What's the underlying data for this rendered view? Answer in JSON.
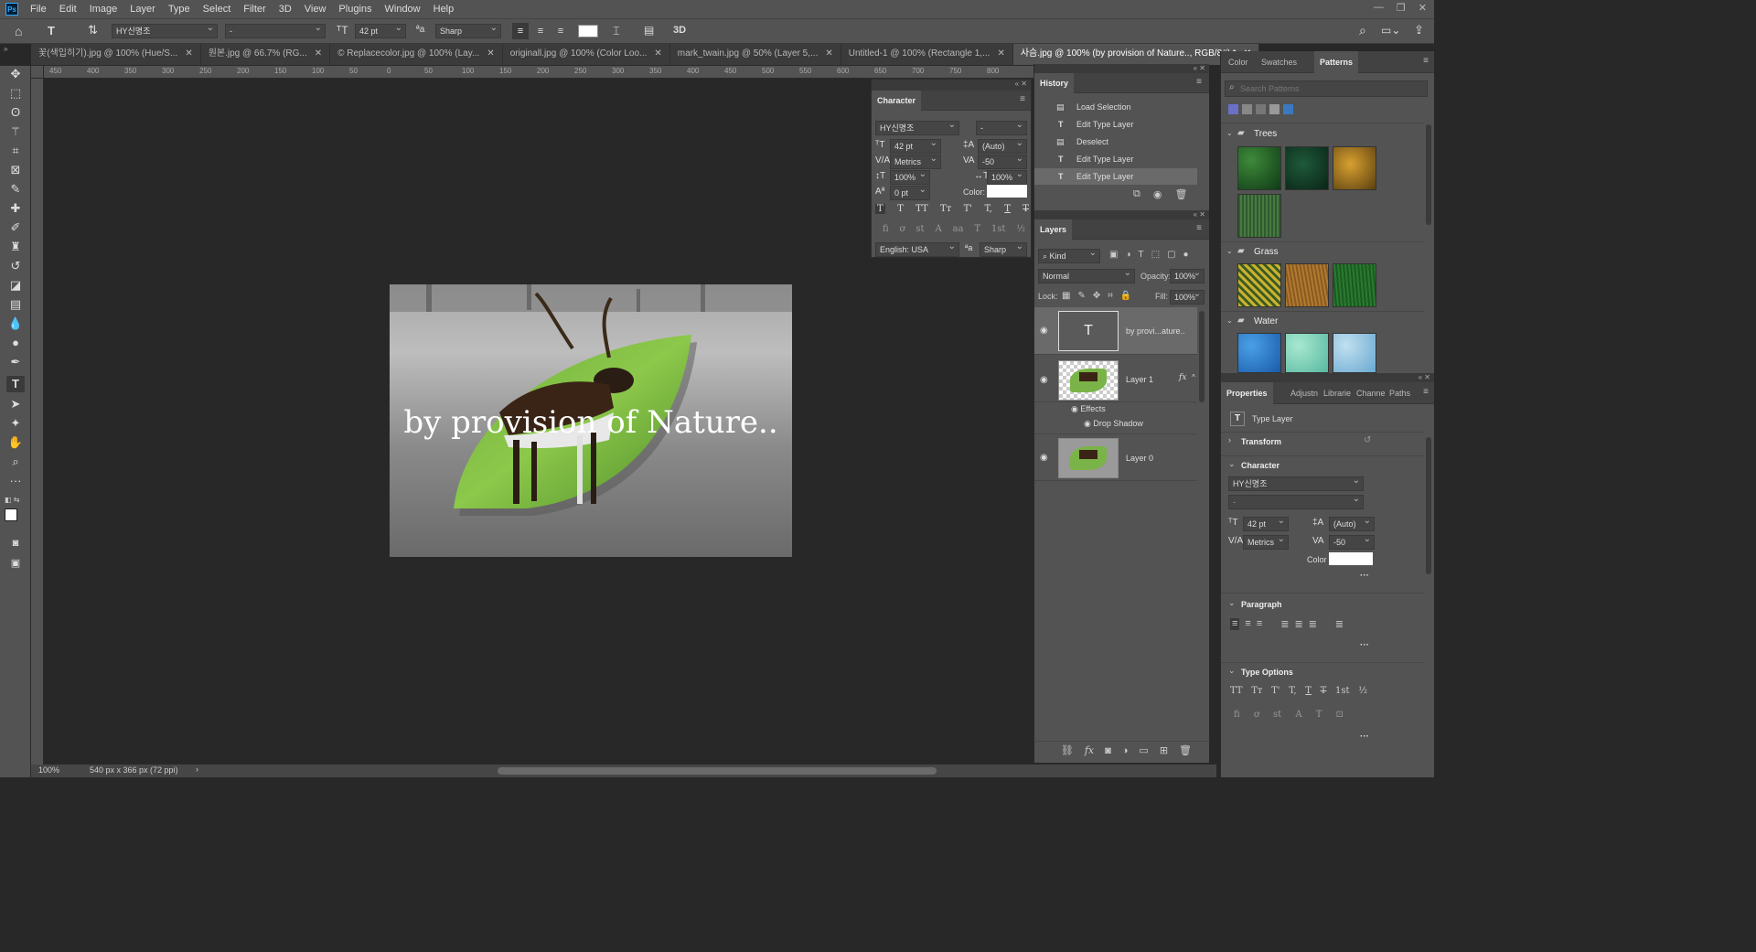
{
  "menubar": {
    "logo": "Ps",
    "items": [
      "File",
      "Edit",
      "Image",
      "Layer",
      "Type",
      "Select",
      "Filter",
      "3D",
      "View",
      "Plugins",
      "Window",
      "Help"
    ]
  },
  "options": {
    "font_family": "HY신명조",
    "font_style": "-",
    "font_size": "42 pt",
    "antialias": "Sharp",
    "threed": "3D"
  },
  "tabs": [
    {
      "label": "꽃(색입히기).jpg @ 100% (Hue/S..."
    },
    {
      "label": "원본.jpg @ 66.7% (RG..."
    },
    {
      "label": "© Replacecolor.jpg @ 100% (Lay..."
    },
    {
      "label": "originall.jpg @ 100% (Color Loo..."
    },
    {
      "label": "mark_twain.jpg @ 50% (Layer 5,..."
    },
    {
      "label": "Untitled-1 @ 100% (Rectangle 1,..."
    },
    {
      "label": "사슴.jpg @ 100% (by provision of Nature.., RGB/8#) *"
    }
  ],
  "ruler_h": [
    "450",
    "400",
    "350",
    "300",
    "250",
    "200",
    "150",
    "100",
    "50",
    "0",
    "50",
    "100",
    "150",
    "200",
    "250",
    "300",
    "350",
    "400",
    "450",
    "500",
    "550",
    "600",
    "650",
    "700",
    "750",
    "800"
  ],
  "canvas": {
    "text": "by provision of Nature.."
  },
  "status": {
    "zoom": "100%",
    "doc": "540 px x 366 px (72 ppi)"
  },
  "character": {
    "title": "Character",
    "font": "HY신명조",
    "style": "-",
    "size": "42 pt",
    "leading": "(Auto)",
    "kerning": "Metrics",
    "tracking": "-50",
    "vscale": "100%",
    "hscale": "100%",
    "baseline": "0 pt",
    "color_label": "Color:",
    "language": "English: USA",
    "antialias": "Sharp",
    "styles": [
      "T",
      "T",
      "TT",
      "Tт",
      "T'",
      "T,",
      "T",
      "T"
    ],
    "ot": [
      "fi",
      "ơ",
      "st",
      "A",
      "aa",
      "T",
      "1st",
      "½"
    ]
  },
  "history": {
    "title": "History",
    "items": [
      "Load Selection",
      "Edit Type Layer",
      "Deselect",
      "Edit Type Layer",
      "Edit Type Layer"
    ]
  },
  "layers": {
    "title": "Layers",
    "kind": "Kind",
    "blend": "Normal",
    "opacity_label": "Opacity:",
    "opacity": "100%",
    "lock_label": "Lock:",
    "fill_label": "Fill:",
    "fill": "100%",
    "rows": [
      {
        "name": "by provi...ature.."
      },
      {
        "name": "Layer 1",
        "fx": "fx"
      },
      {
        "name": "Layer 0"
      }
    ],
    "effects": "Effects",
    "drop_shadow": "Drop Shadow"
  },
  "patterns": {
    "tabs": [
      "Color",
      "Swatches",
      "Patterns"
    ],
    "search_placeholder": "Search Patterns",
    "groups": [
      "Trees",
      "Grass",
      "Water"
    ]
  },
  "properties": {
    "tabs": [
      "Properties",
      "Adjustn",
      "Librarie",
      "Channe",
      "Paths"
    ],
    "type_layer": "Type Layer",
    "transform": "Transform",
    "character": "Character",
    "font": "HY신명조",
    "style": "-",
    "size": "42 pt",
    "leading": "(Auto)",
    "kerning": "Metrics",
    "tracking": "-50",
    "color_label": "Color",
    "paragraph": "Paragraph",
    "type_options": "Type Options",
    "more": "···"
  }
}
